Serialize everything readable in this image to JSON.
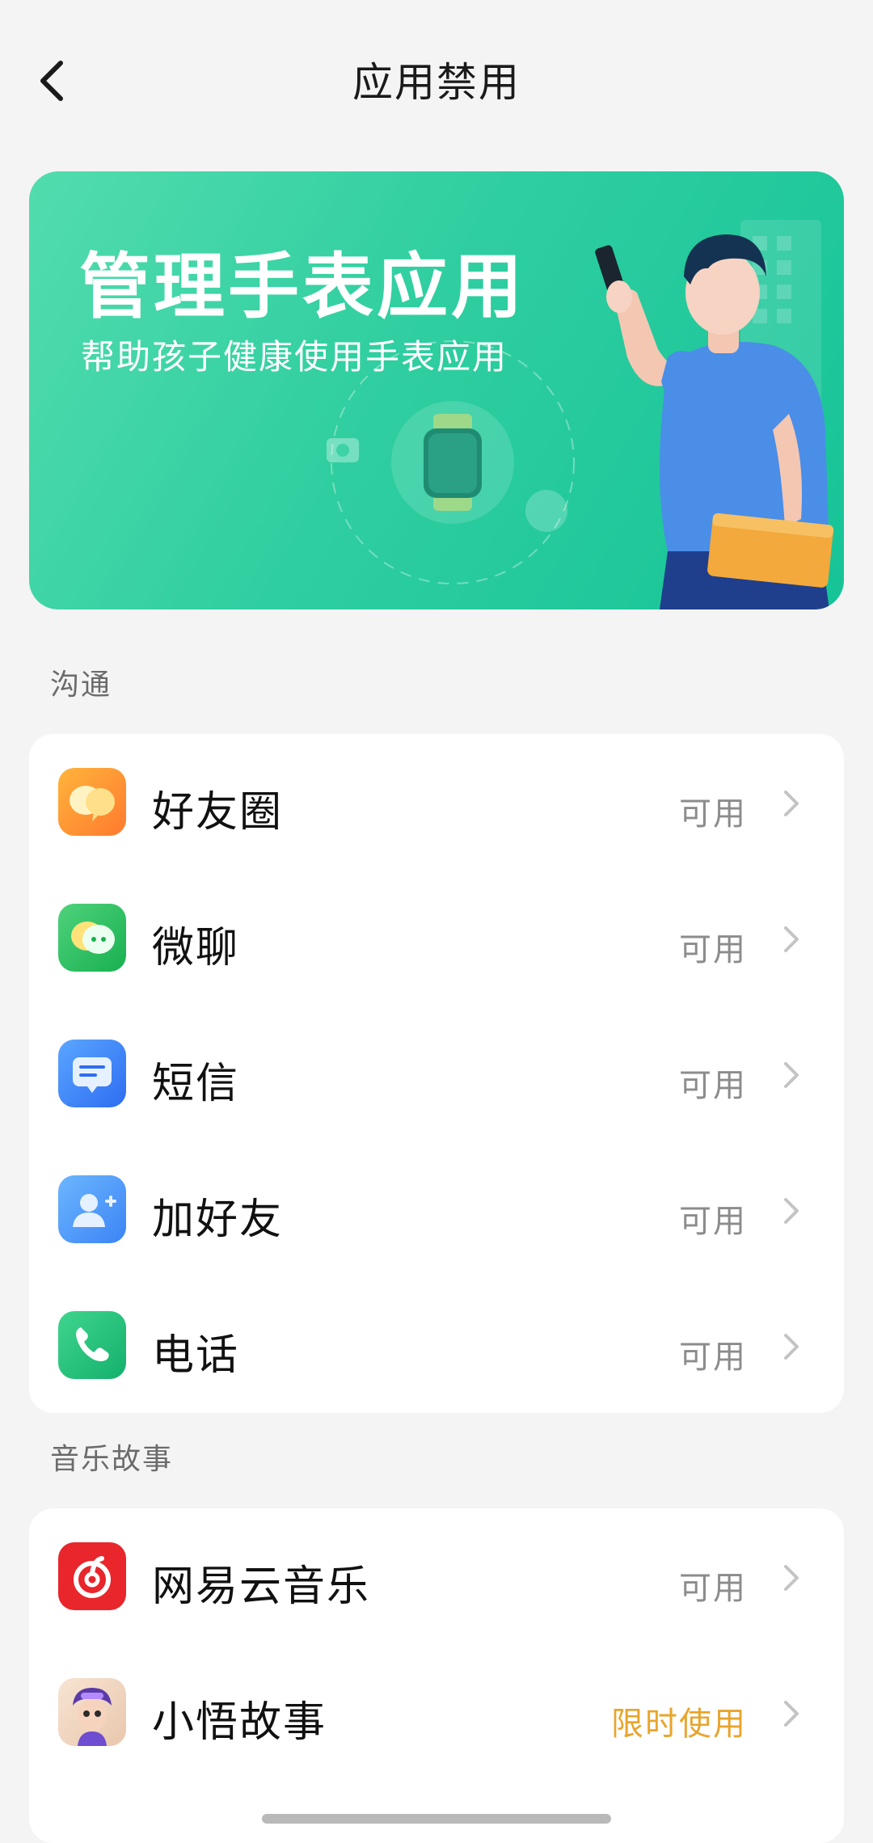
{
  "header": {
    "title": "应用禁用"
  },
  "banner": {
    "title": "管理手表应用",
    "subtitle": "帮助孩子健康使用手表应用"
  },
  "sections": [
    {
      "label": "沟通",
      "items": [
        {
          "name": "好友圈",
          "status": "可用",
          "icon": "friends-circle-icon"
        },
        {
          "name": "微聊",
          "status": "可用",
          "icon": "chat-icon"
        },
        {
          "name": "短信",
          "status": "可用",
          "icon": "sms-icon"
        },
        {
          "name": "加好友",
          "status": "可用",
          "icon": "add-friend-icon"
        },
        {
          "name": "电话",
          "status": "可用",
          "icon": "phone-icon"
        }
      ]
    },
    {
      "label": "音乐故事",
      "items": [
        {
          "name": "网易云音乐",
          "status": "可用",
          "icon": "netease-music-icon"
        },
        {
          "name": "小悟故事",
          "status": "限时使用",
          "icon": "xiaowu-story-icon"
        }
      ]
    }
  ],
  "colors": {
    "background": "#f4f4f4",
    "banner_green": "#2fcea0",
    "status_available": "#8c8c8c",
    "status_limited": "#e8a52c"
  }
}
